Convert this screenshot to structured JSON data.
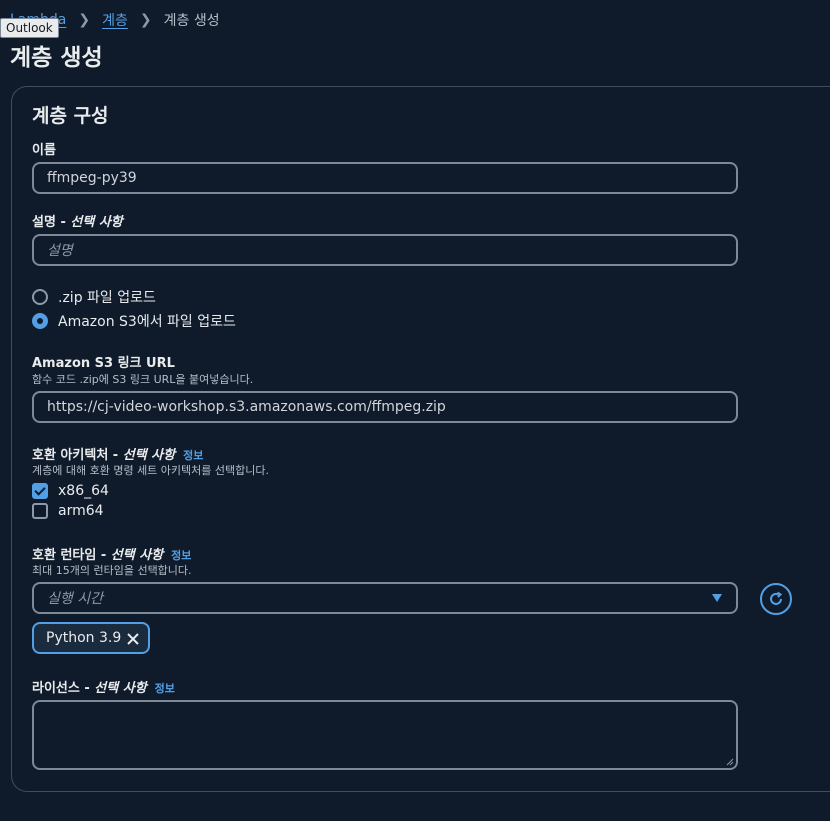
{
  "breadcrumb": {
    "items": [
      "Lambda",
      "계층"
    ],
    "current": "계층 생성"
  },
  "tooltip": "Outlook",
  "page_title": "계층 생성",
  "panel": {
    "title": "계층 구성",
    "name": {
      "label": "이름",
      "value": "ffmpeg-py39"
    },
    "description": {
      "label": "설명 - ",
      "optional": "선택 사항",
      "placeholder": "설명"
    },
    "upload_options": [
      {
        "label": ".zip 파일 업로드",
        "selected": false
      },
      {
        "label": "Amazon S3에서 파일 업로드",
        "selected": true
      }
    ],
    "s3_url": {
      "label": "Amazon S3 링크 URL",
      "description": "함수 코드 .zip에 S3 링크 URL을 붙여넣습니다.",
      "value": "https://cj-video-workshop.s3.amazonaws.com/ffmpeg.zip"
    },
    "architecture": {
      "label": "호환 아키텍처 - ",
      "optional": "선택 사항",
      "info": "정보",
      "description": "계층에 대해 호환 명령 세트 아키텍처를 선택합니다.",
      "options": [
        {
          "label": "x86_64",
          "checked": true
        },
        {
          "label": "arm64",
          "checked": false
        }
      ]
    },
    "runtime": {
      "label": "호환 런타임 - ",
      "optional": "선택 사항",
      "info": "정보",
      "description": "최대 15개의 런타임을 선택합니다.",
      "placeholder": "실행 시간",
      "selected_token": "Python 3.9"
    },
    "license": {
      "label": "라이선스 - ",
      "optional": "선택 사항",
      "info": "정보",
      "value": ""
    }
  },
  "colors": {
    "background": "#0f1b2a",
    "accent": "#539fe5",
    "border": "#7d8998"
  }
}
